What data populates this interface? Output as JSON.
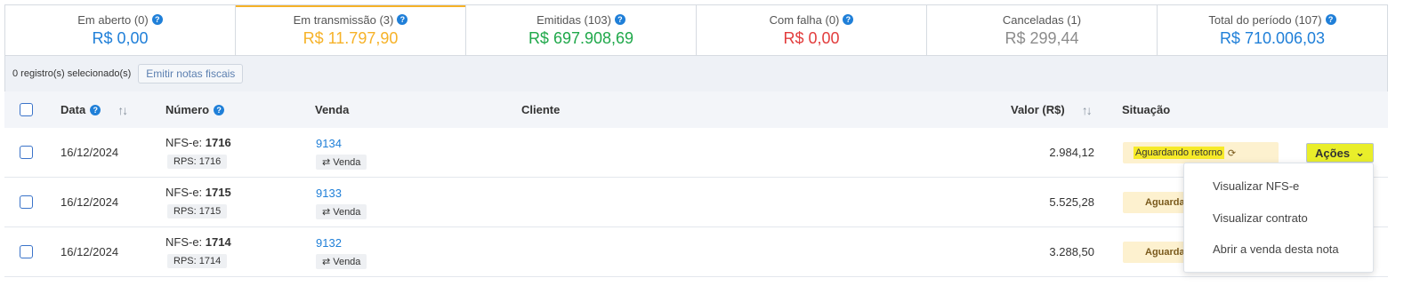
{
  "tabs": [
    {
      "label": "Em aberto (0)",
      "value": "R$ 0,00",
      "color": "#1f7fd8",
      "help": true
    },
    {
      "label": "Em transmissão (3)",
      "value": "R$ 11.797,90",
      "color": "#f6b228",
      "help": true
    },
    {
      "label": "Emitidas (103)",
      "value": "R$ 697.908,69",
      "color": "#1fa84a",
      "help": true
    },
    {
      "label": "Com falha (0)",
      "value": "R$ 0,00",
      "color": "#e23d3d",
      "help": true
    },
    {
      "label": "Canceladas (1)",
      "value": "R$ 299,44",
      "color": "#8c8c8c",
      "help": false
    },
    {
      "label": "Total do período (107)",
      "value": "R$ 710.006,03",
      "color": "#1f7fd8",
      "help": true
    }
  ],
  "toolbar": {
    "selected_text": "0 registro(s) selecionado(s)",
    "emit_label": "Emitir notas fiscais"
  },
  "table": {
    "headers": {
      "data": "Data",
      "numero": "Número",
      "venda": "Venda",
      "cliente": "Cliente",
      "valor": "Valor (R$)",
      "situacao": "Situação"
    },
    "rows": [
      {
        "date": "16/12/2024",
        "nf_prefix": "NFS-e:",
        "nf_number": "1716",
        "rps": "RPS: 1716",
        "venda_id": "9134",
        "venda_tag": "Venda",
        "valor": "2.984,12",
        "status": "Aguardando retorno"
      },
      {
        "date": "16/12/2024",
        "nf_prefix": "NFS-e:",
        "nf_number": "1715",
        "rps": "RPS: 1715",
        "venda_id": "9133",
        "venda_tag": "Venda",
        "valor": "5.525,28",
        "status": "Aguarda"
      },
      {
        "date": "16/12/2024",
        "nf_prefix": "NFS-e:",
        "nf_number": "1714",
        "rps": "RPS: 1714",
        "venda_id": "9132",
        "venda_tag": "Venda",
        "valor": "3.288,50",
        "status": "Aguarda"
      }
    ],
    "acoes_label": "Ações"
  },
  "dropdown": {
    "items": [
      "Visualizar NFS-e",
      "Visualizar contrato",
      "Abrir a venda desta nota"
    ]
  }
}
